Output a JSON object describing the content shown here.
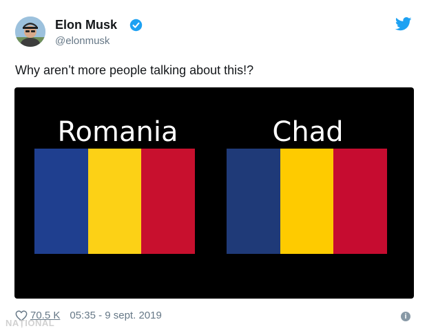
{
  "author": {
    "name": "Elon Musk",
    "handle": "@elonmusk",
    "avatar_icon": "profile-photo",
    "verified_icon": "verified-badge-icon"
  },
  "tweet": {
    "text": "Why aren’t more people talking about this!?"
  },
  "media": {
    "background": "#000000",
    "flags": [
      {
        "title": "Romania",
        "colors": [
          "#1f3f8f",
          "#fcd116",
          "#c8102e"
        ]
      },
      {
        "title": "Chad",
        "colors": [
          "#1f3a78",
          "#fecb00",
          "#c60c30"
        ]
      }
    ]
  },
  "footer": {
    "likes": "70.5 K",
    "timestamp": "05:35 - 9 sept. 2019",
    "heart_icon": "heart-icon",
    "info_icon": "info-icon"
  },
  "brand": {
    "icon": "twitter-bird-icon",
    "color": "#1da1f2"
  },
  "watermark": {
    "text": "NAȚIONAL"
  }
}
